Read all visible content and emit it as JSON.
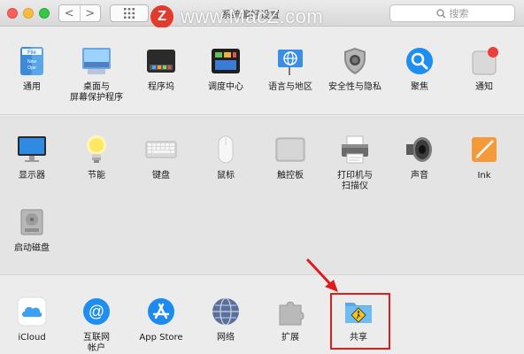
{
  "window": {
    "title": "系统偏好设置",
    "search_placeholder": "搜索",
    "nav_back": "<",
    "nav_forward": ">"
  },
  "watermark": {
    "logo": "Z",
    "text": "www.MacZ.com"
  },
  "sections": [
    {
      "items": [
        {
          "label": "通用",
          "icon": "general-icon"
        },
        {
          "label": "桌面与\n屏幕保护程序",
          "icon": "desktop-screensaver-icon"
        },
        {
          "label": "程序坞",
          "icon": "dock-icon"
        },
        {
          "label": "调度中心",
          "icon": "mission-control-icon"
        },
        {
          "label": "语言与地区",
          "icon": "language-region-icon"
        },
        {
          "label": "安全性与隐私",
          "icon": "security-privacy-icon"
        },
        {
          "label": "聚焦",
          "icon": "spotlight-icon"
        },
        {
          "label": "通知",
          "icon": "notifications-icon"
        }
      ]
    },
    {
      "items": [
        {
          "label": "显示器",
          "icon": "displays-icon"
        },
        {
          "label": "节能",
          "icon": "energy-saver-icon"
        },
        {
          "label": "键盘",
          "icon": "keyboard-icon"
        },
        {
          "label": "鼠标",
          "icon": "mouse-icon"
        },
        {
          "label": "触控板",
          "icon": "trackpad-icon"
        },
        {
          "label": "打印机与\n扫描仪",
          "icon": "printers-scanners-icon"
        },
        {
          "label": "声音",
          "icon": "sound-icon"
        },
        {
          "label": "Ink",
          "icon": "ink-icon"
        },
        {
          "label": "启动磁盘",
          "icon": "startup-disk-icon"
        }
      ]
    },
    {
      "items": [
        {
          "label": "iCloud",
          "icon": "icloud-icon"
        },
        {
          "label": "互联网\n帐户",
          "icon": "internet-accounts-icon"
        },
        {
          "label": "App Store",
          "icon": "app-store-icon"
        },
        {
          "label": "网络",
          "icon": "network-icon"
        },
        {
          "label": "扩展",
          "icon": "extensions-icon"
        },
        {
          "label": "共享",
          "icon": "sharing-icon"
        }
      ]
    }
  ],
  "annotation": {
    "highlight_color": "#e01b1b",
    "target": "共享"
  }
}
